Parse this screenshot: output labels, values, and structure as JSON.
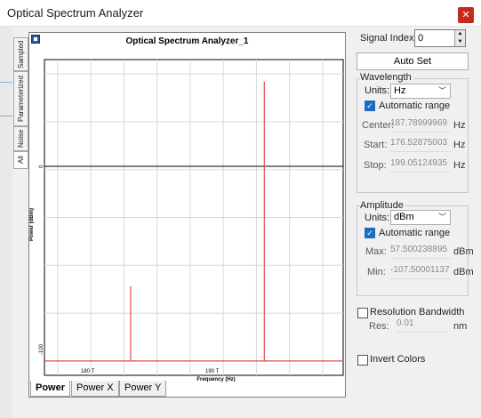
{
  "window": {
    "title": "Optical Spectrum Analyzer",
    "close_symbol": "✕"
  },
  "side_tabs": [
    "Sampled",
    "Parameterized",
    "Noise",
    "All"
  ],
  "graph": {
    "title": "Optical Spectrum Analyzer_1",
    "ylabel": "Power (dBm)",
    "xlabel": "Frequency (Hz)",
    "ytick_0": "0",
    "ytick_100": "-100",
    "xtick_180": "180 T",
    "xtick_190": "190 T"
  },
  "chart_data": {
    "type": "line",
    "title": "Optical Spectrum Analyzer_1",
    "xlabel": "Frequency (Hz)",
    "ylabel": "Power (dBm)",
    "xlim": [
      176.5,
      199.05
    ],
    "ylim": [
      -107.5,
      57.5
    ],
    "series": [
      {
        "x": [
          176.5,
          183.0,
          183.0,
          183.0,
          193.1,
          193.1,
          193.1,
          199.05
        ],
        "values": [
          -100,
          -100,
          -61,
          -100,
          -100,
          46,
          -100,
          -100
        ]
      }
    ],
    "color": "#e05050",
    "grid": true
  },
  "bottom_tabs": [
    "Power",
    "Power X",
    "Power Y"
  ],
  "controls": {
    "signal_index_label": "Signal Index:",
    "signal_index_value": "0",
    "auto_set": "Auto Set",
    "wavelength": {
      "heading": "Wavelength",
      "units_label": "Units:",
      "units_value": "Hz",
      "auto_range": "Automatic range",
      "center_label": "Center:",
      "center_value": "187.78999969",
      "start_label": "Start:",
      "start_value": "176.52875003",
      "stop_label": "Stop:",
      "stop_value": "199.05124935",
      "unit": "Hz"
    },
    "amplitude": {
      "heading": "Amplitude",
      "units_label": "Units:",
      "units_value": "dBm",
      "auto_range": "Automatic range",
      "max_label": "Max:",
      "max_value": "57.500238895",
      "min_label": "Min:",
      "min_value": "-107.50001137",
      "unit": "dBm"
    },
    "resolution": {
      "label": "Resolution Bandwidth",
      "res_label": "Res:",
      "res_value": "0.01",
      "unit": "nm"
    },
    "invert": {
      "label": "Invert Colors"
    }
  }
}
